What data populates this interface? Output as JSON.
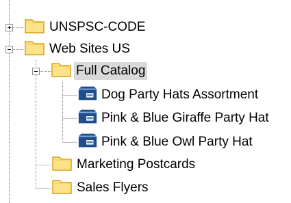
{
  "tree": {
    "nodes": [
      {
        "label": "UNSPSC-CODE",
        "icon": "folder-icon",
        "expander": "plus",
        "selected": false
      },
      {
        "label": "Web Sites US",
        "icon": "folder-icon",
        "expander": "minus",
        "selected": false
      },
      {
        "label": "Full Catalog",
        "icon": "folder-icon",
        "expander": "minus",
        "selected": true
      },
      {
        "label": "Dog Party Hats Assortment",
        "icon": "product-icon",
        "expander": "none",
        "selected": false
      },
      {
        "label": "Pink & Blue Giraffe Party Hat",
        "icon": "product-icon",
        "expander": "none",
        "selected": false
      },
      {
        "label": "Pink & Blue Owl Party Hat",
        "icon": "product-icon",
        "expander": "none",
        "selected": false
      },
      {
        "label": "Marketing Postcards",
        "icon": "folder-icon",
        "expander": "none",
        "selected": false
      },
      {
        "label": "Sales Flyers",
        "icon": "folder-icon",
        "expander": "none",
        "selected": false
      }
    ]
  },
  "colors": {
    "folder_fill": "#fde28a",
    "folder_stroke": "#d8a21c",
    "product_fill": "#1f4e8c",
    "selection_bg": "#d9d9d9"
  }
}
